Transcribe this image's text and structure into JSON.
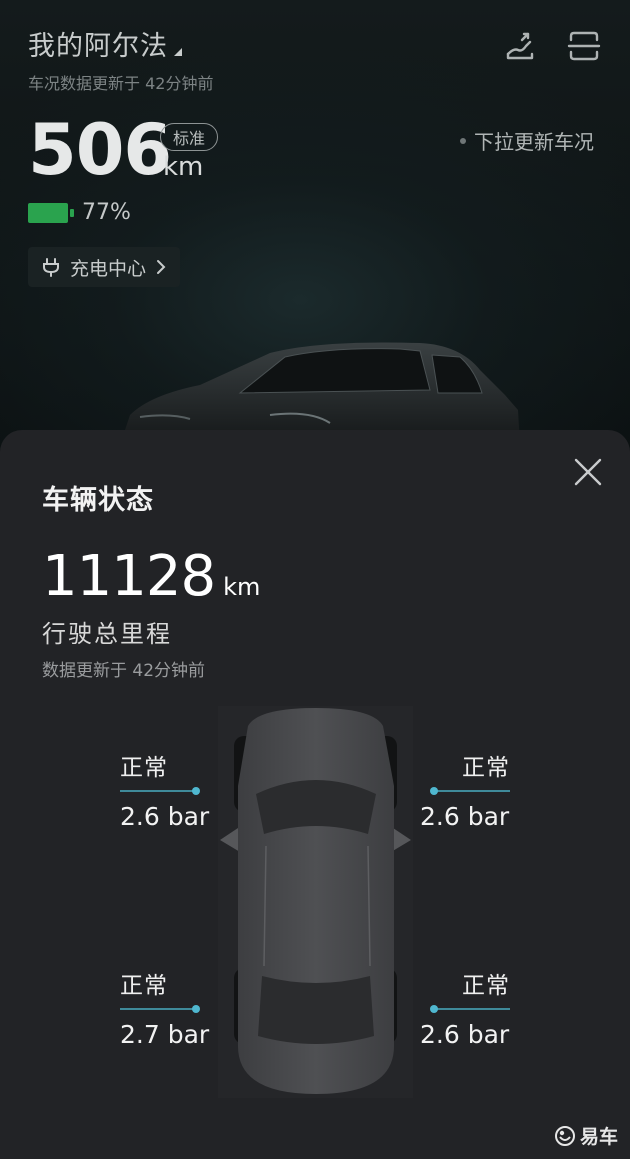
{
  "header": {
    "car_name": "我的阿尔法",
    "update_time": "车况数据更新于 42分钟前",
    "pull_hint": "下拉更新车况"
  },
  "range": {
    "value": "506",
    "unit": "km",
    "mode_badge": "标准"
  },
  "battery": {
    "percent_text": "77%",
    "level": 0.77,
    "color": "#2aa34e"
  },
  "charge_center": {
    "label": "充电中心"
  },
  "icons": {
    "top_left": "share-icon",
    "top_right": "scan-icon",
    "close": "close-icon",
    "charge": "plug-icon"
  },
  "sheet": {
    "title": "车辆状态",
    "odometer_value": "11128",
    "odometer_unit": "km",
    "odometer_label": "行驶总里程",
    "data_update": "数据更新于 42分钟前"
  },
  "tires": [
    {
      "position": "front-left",
      "status": "正常",
      "pressure": "2.6 bar"
    },
    {
      "position": "front-right",
      "status": "正常",
      "pressure": "2.6 bar"
    },
    {
      "position": "rear-left",
      "status": "正常",
      "pressure": "2.7 bar"
    },
    {
      "position": "rear-right",
      "status": "正常",
      "pressure": "2.6 bar"
    }
  ],
  "watermark": {
    "text": "易车"
  },
  "colors": {
    "accent": "#4fb7cf",
    "sheet_bg": "#222326"
  }
}
